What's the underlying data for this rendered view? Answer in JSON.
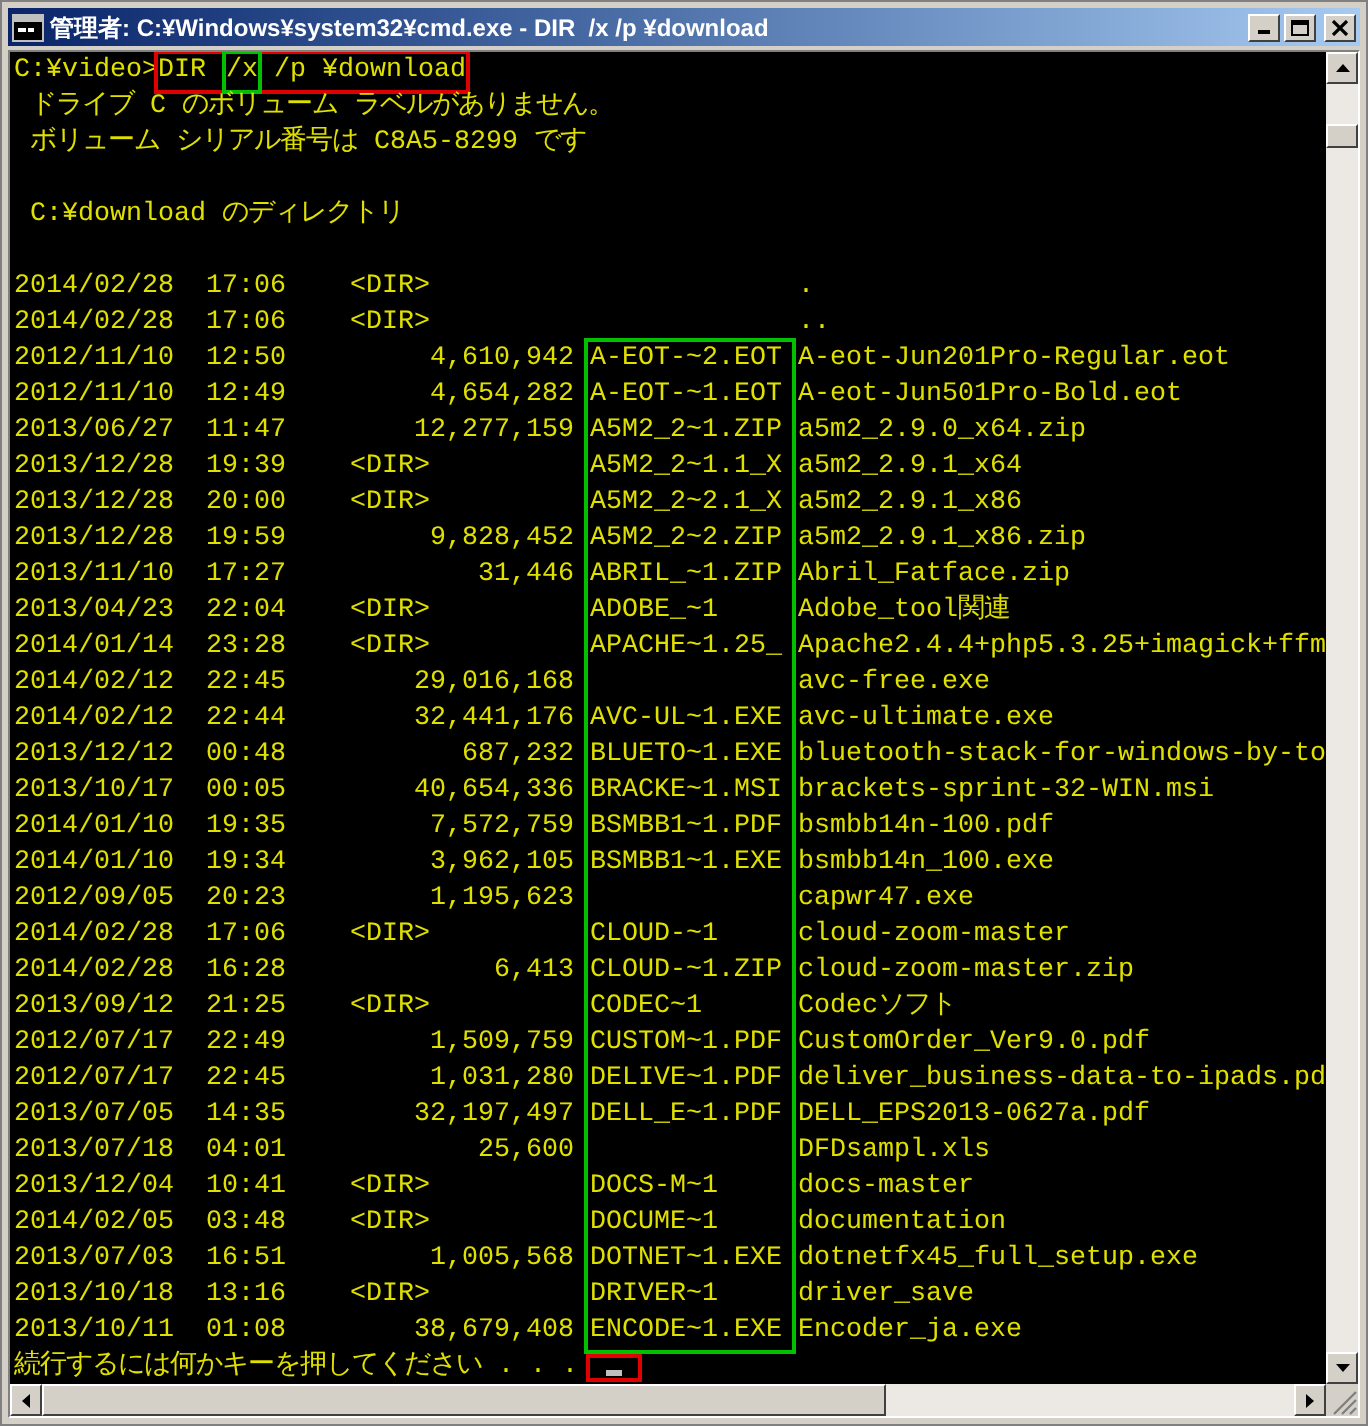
{
  "window": {
    "title": "管理者: C:¥Windows¥system32¥cmd.exe - DIR  /x /p ¥download"
  },
  "command": {
    "prompt": "C:¥video>",
    "name": "DIR",
    "option": "/x",
    "arguments": "/p ¥download"
  },
  "header_lines": [
    {
      "kind": "text",
      "text": " ドライブ C のボリューム ラベルがありません。"
    },
    {
      "kind": "text",
      "text": " ボリューム シリアル番号は C8A5-8299 です"
    },
    {
      "kind": "blank"
    },
    {
      "kind": "text",
      "text": " C:¥download のディレクトリ"
    },
    {
      "kind": "blank"
    }
  ],
  "rows": [
    {
      "date": "2014/02/28",
      "time": "17:06",
      "dir": "<DIR>",
      "long_name": "."
    },
    {
      "date": "2014/02/28",
      "time": "17:06",
      "dir": "<DIR>",
      "long_name": ".."
    },
    {
      "date": "2012/11/10",
      "time": "12:50",
      "size": "4,610,942",
      "short_name": "A-EOT-~2.EOT",
      "long_name": "A-eot-Jun201Pro-Regular.eot"
    },
    {
      "date": "2012/11/10",
      "time": "12:49",
      "size": "4,654,282",
      "short_name": "A-EOT-~1.EOT",
      "long_name": "A-eot-Jun501Pro-Bold.eot"
    },
    {
      "date": "2013/06/27",
      "time": "11:47",
      "size": "12,277,159",
      "short_name": "A5M2_2~1.ZIP",
      "long_name": "a5m2_2.9.0_x64.zip"
    },
    {
      "date": "2013/12/28",
      "time": "19:39",
      "dir": "<DIR>",
      "short_name": "A5M2_2~1.1_X",
      "long_name": "a5m2_2.9.1_x64"
    },
    {
      "date": "2013/12/28",
      "time": "20:00",
      "dir": "<DIR>",
      "short_name": "A5M2_2~2.1_X",
      "long_name": "a5m2_2.9.1_x86"
    },
    {
      "date": "2013/12/28",
      "time": "19:59",
      "size": "9,828,452",
      "short_name": "A5M2_2~2.ZIP",
      "long_name": "a5m2_2.9.1_x86.zip"
    },
    {
      "date": "2013/11/10",
      "time": "17:27",
      "size": "31,446",
      "short_name": "ABRIL_~1.ZIP",
      "long_name": "Abril_Fatface.zip"
    },
    {
      "date": "2013/04/23",
      "time": "22:04",
      "dir": "<DIR>",
      "short_name": "ADOBE_~1",
      "long_name": "Adobe_tool関連"
    },
    {
      "date": "2014/01/14",
      "time": "23:28",
      "dir": "<DIR>",
      "short_name": "APACHE~1.25_",
      "long_name": "Apache2.4.4+php5.3.25+imagick+ffm"
    },
    {
      "date": "2014/02/12",
      "time": "22:45",
      "size": "29,016,168",
      "long_name": "avc-free.exe"
    },
    {
      "date": "2014/02/12",
      "time": "22:44",
      "size": "32,441,176",
      "short_name": "AVC-UL~1.EXE",
      "long_name": "avc-ultimate.exe"
    },
    {
      "date": "2013/12/12",
      "time": "00:48",
      "size": "687,232",
      "short_name": "BLUETO~1.EXE",
      "long_name": "bluetooth-stack-for-windows-by-to"
    },
    {
      "date": "2013/10/17",
      "time": "00:05",
      "size": "40,654,336",
      "short_name": "BRACKE~1.MSI",
      "long_name": "brackets-sprint-32-WIN.msi"
    },
    {
      "date": "2014/01/10",
      "time": "19:35",
      "size": "7,572,759",
      "short_name": "BSMBB1~1.PDF",
      "long_name": "bsmbb14n-100.pdf"
    },
    {
      "date": "2014/01/10",
      "time": "19:34",
      "size": "3,962,105",
      "short_name": "BSMBB1~1.EXE",
      "long_name": "bsmbb14n_100.exe"
    },
    {
      "date": "2012/09/05",
      "time": "20:23",
      "size": "1,195,623",
      "long_name": "capwr47.exe"
    },
    {
      "date": "2014/02/28",
      "time": "17:06",
      "dir": "<DIR>",
      "short_name": "CLOUD-~1",
      "long_name": "cloud-zoom-master"
    },
    {
      "date": "2014/02/28",
      "time": "16:28",
      "size": "6,413",
      "short_name": "CLOUD-~1.ZIP",
      "long_name": "cloud-zoom-master.zip"
    },
    {
      "date": "2013/09/12",
      "time": "21:25",
      "dir": "<DIR>",
      "short_name": "CODEC~1",
      "long_name": "Codecソフト"
    },
    {
      "date": "2012/07/17",
      "time": "22:49",
      "size": "1,509,759",
      "short_name": "CUSTOM~1.PDF",
      "long_name": "CustomOrder_Ver9.0.pdf"
    },
    {
      "date": "2012/07/17",
      "time": "22:45",
      "size": "1,031,280",
      "short_name": "DELIVE~1.PDF",
      "long_name": "deliver_business-data-to-ipads.pd"
    },
    {
      "date": "2013/07/05",
      "time": "14:35",
      "size": "32,197,497",
      "short_name": "DELL_E~1.PDF",
      "long_name": "DELL_EPS2013-0627a.pdf"
    },
    {
      "date": "2013/07/18",
      "time": "04:01",
      "size": "25,600",
      "long_name": "DFDsampl.xls"
    },
    {
      "date": "2013/12/04",
      "time": "10:41",
      "dir": "<DIR>",
      "short_name": "DOCS-M~1",
      "long_name": "docs-master"
    },
    {
      "date": "2014/02/05",
      "time": "03:48",
      "dir": "<DIR>",
      "short_name": "DOCUME~1",
      "long_name": "documentation"
    },
    {
      "date": "2013/07/03",
      "time": "16:51",
      "size": "1,005,568",
      "short_name": "DOTNET~1.EXE",
      "long_name": "dotnetfx45_full_setup.exe"
    },
    {
      "date": "2013/10/18",
      "time": "13:16",
      "dir": "<DIR>",
      "short_name": "DRIVER~1",
      "long_name": "driver_save"
    },
    {
      "date": "2013/10/11",
      "time": "01:08",
      "size": "38,679,408",
      "short_name": "ENCODE~1.EXE",
      "long_name": "Encoder_ja.exe"
    }
  ],
  "pause_prompt": "続行するには何かキーを押してください . . ."
}
